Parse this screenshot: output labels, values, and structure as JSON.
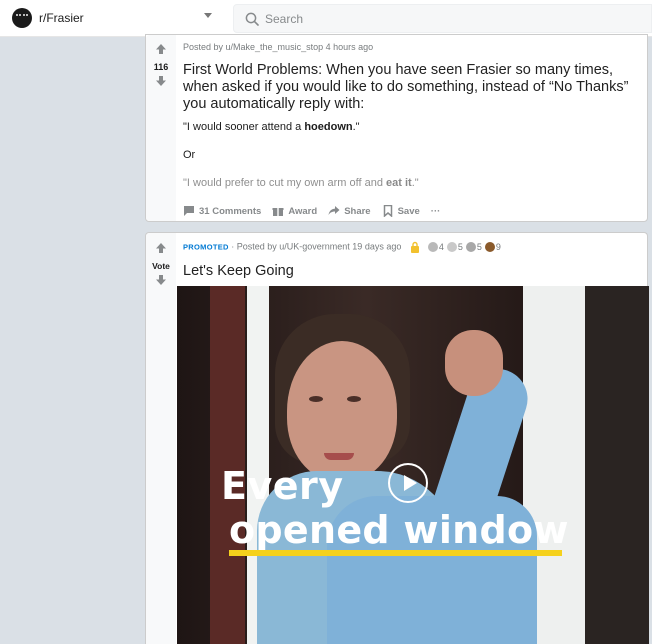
{
  "header": {
    "subreddit": "r/Frasier",
    "search_placeholder": "Search"
  },
  "posts": [
    {
      "votes": "116",
      "meta": "Posted by u/Make_the_music_stop 4 hours ago",
      "title": "First World Problems: When you have seen Frasier so many times, when asked if you would like to do something, instead of “No Thanks” you automatically reply with:",
      "body": {
        "line1_pre": "\"I would sooner attend a ",
        "line1_bold": "hoedown",
        "line1_post": ".\"",
        "line2": "Or",
        "line3_pre": "\"I would prefer to cut my own arm off and ",
        "line3_bold": "eat it",
        "line3_post": ".\""
      },
      "actions": {
        "comments": "31 Comments",
        "award": "Award",
        "share": "Share",
        "save": "Save",
        "more": "···"
      }
    },
    {
      "votes": "Vote",
      "promoted": "PROMOTED",
      "meta": "· Posted by u/UK-government 19 days ago",
      "awards": [
        {
          "icon": "helpful-award-icon",
          "count": "4",
          "color": "#b9b9b9"
        },
        {
          "icon": "wholesome-award-icon",
          "count": "5",
          "color": "#c9c9c9"
        },
        {
          "icon": "silver-award-icon",
          "count": "5",
          "color": "#a8a8a8"
        },
        {
          "icon": "bear-award-icon",
          "count": "9",
          "color": "#8a5a2b"
        }
      ],
      "title": "Let's Keep Going",
      "media": {
        "headline_line1": "Every",
        "headline_line2": "opened window",
        "accent": "#f5d11c"
      }
    }
  ],
  "colors": {
    "page_bg": "#dae0e6",
    "promoted_blue": "#0079d3",
    "meta_gray": "#787c7e"
  }
}
